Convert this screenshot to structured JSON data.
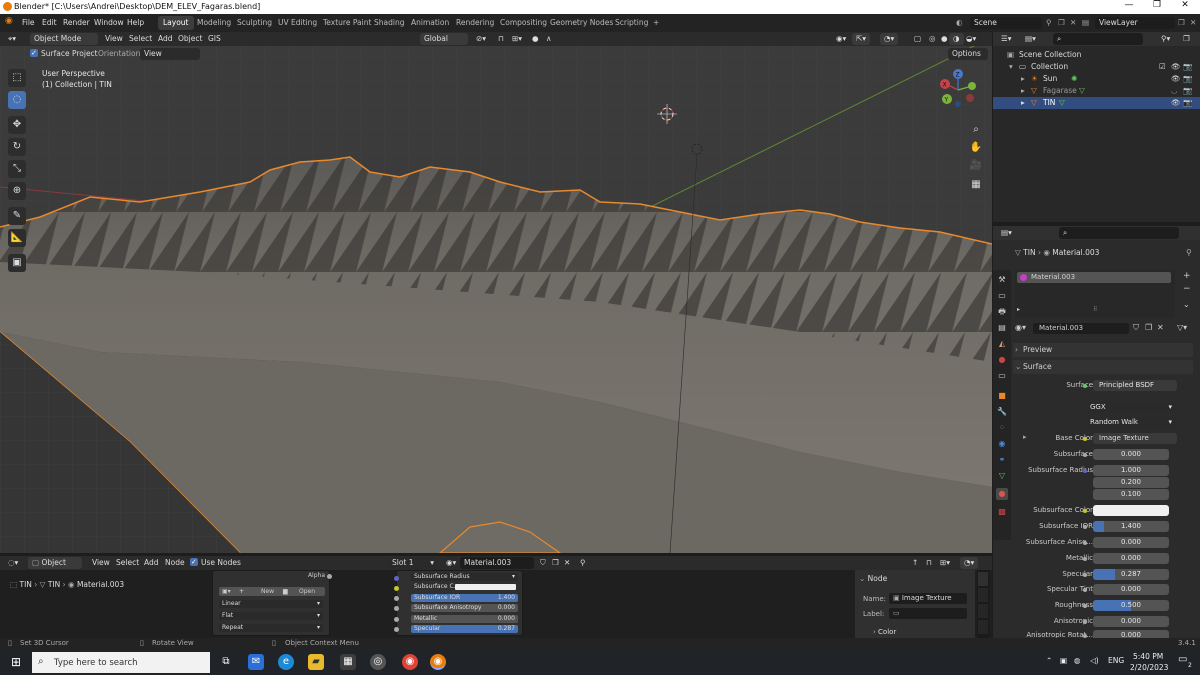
{
  "window": {
    "title": "Blender* [C:\\Users\\Andrei\\Desktop\\DEM_ELEV_Fagaras.blend]",
    "controls": [
      "—",
      "❐",
      "✕"
    ]
  },
  "menu": {
    "items": [
      "File",
      "Edit",
      "Render",
      "Window",
      "Help"
    ],
    "workspaces": [
      "Layout",
      "Modeling",
      "Sculpting",
      "UV Editing",
      "Texture Paint",
      "Shading",
      "Animation",
      "Rendering",
      "Compositing",
      "Geometry Nodes",
      "Scripting"
    ],
    "add_tab": "+",
    "scene": "Scene",
    "view_layer": "ViewLayer"
  },
  "viewport": {
    "mode": "Object Mode",
    "header_menus": [
      "View",
      "Select",
      "Add",
      "Object",
      "GIS"
    ],
    "transform_orientation": "Global",
    "surface_project": "Surface Project",
    "orientation_label": "Orientation:",
    "orientation_value": "View",
    "options": "Options",
    "overlay_title": "User Perspective",
    "overlay_sub": "(1) Collection | TIN",
    "gizmo": {
      "x": "X",
      "y": "Y",
      "z": "Z"
    }
  },
  "outliner": {
    "search_placeholder": "",
    "rows": [
      {
        "label": "Scene Collection"
      },
      {
        "label": "Collection"
      },
      {
        "label": "Sun"
      },
      {
        "label": "Fagarase"
      },
      {
        "label": "TIN"
      }
    ]
  },
  "properties": {
    "breadcrumb_obj": "TIN",
    "breadcrumb_mat": "Material.003",
    "slot_material": "Material.003",
    "material_name": "Material.003",
    "preview": "Preview",
    "surface_section": "Surface",
    "rows": [
      {
        "label": "Surface",
        "value": "Principled BSDF"
      },
      {
        "label": "",
        "value": "GGX"
      },
      {
        "label": "",
        "value": "Random Walk"
      },
      {
        "label": "Base Color",
        "value": "Image Texture"
      },
      {
        "label": "Subsurface",
        "value": "0.000"
      },
      {
        "label": "Subsurface Radius",
        "value": "1.000"
      },
      {
        "label": "",
        "value": "0.200"
      },
      {
        "label": "",
        "value": "0.100"
      },
      {
        "label": "Subsurface Color",
        "value": ""
      },
      {
        "label": "Subsurface IOR",
        "value": "1.400"
      },
      {
        "label": "Subsurface Aniso...",
        "value": "0.000"
      },
      {
        "label": "Metallic",
        "value": "0.000"
      },
      {
        "label": "Specular",
        "value": "0.287"
      },
      {
        "label": "Specular Tint",
        "value": "0.000"
      },
      {
        "label": "Roughness",
        "value": "0.500"
      },
      {
        "label": "Anisotropic",
        "value": "0.000"
      },
      {
        "label": "Anisotropic Rotat...",
        "value": "0.000"
      }
    ],
    "fills": {
      "subsurface_ior": 0.14,
      "specular": 0.287,
      "roughness": 0.5
    }
  },
  "node_editor": {
    "editor_type": "Object",
    "menus": [
      "View",
      "Select",
      "Add",
      "Node"
    ],
    "use_nodes": "Use Nodes",
    "slot": "Slot 1",
    "material": "Material.003",
    "breadcrumb": [
      "TIN",
      "TIN",
      "Material.003"
    ],
    "image_node": {
      "alpha": "Alpha",
      "new": "New",
      "open": "Open",
      "interp": "Linear",
      "proj": "Flat",
      "ext": "Repeat"
    },
    "bsdf_node": {
      "rows": [
        {
          "label": "Subsurface Radius",
          "value": ""
        },
        {
          "label": "Subsurface C...",
          "value": ""
        },
        {
          "label": "Subsurface IOR",
          "value": "1.400"
        },
        {
          "label": "Subsurface Anisotropy",
          "value": "0.000"
        },
        {
          "label": "Metallic",
          "value": "0.000"
        },
        {
          "label": "Specular",
          "value": "0.287"
        }
      ]
    },
    "side_panel": {
      "section": "Node",
      "name_label": "Name:",
      "name_value": "Image Texture",
      "label_label": "Label:",
      "color_section": "Color"
    }
  },
  "statusbar": {
    "left": "Set 3D Cursor",
    "mid": "Rotate View",
    "right": "Object Context Menu",
    "version": "3.4.1"
  },
  "taskbar": {
    "search_placeholder": "Type here to search",
    "lang": "ENG",
    "time": "5:40 PM",
    "date": "2/20/2023",
    "notif_count": "2"
  },
  "colors": {
    "accent": "#4772b3",
    "selection_outline": "#e8892d",
    "outliner_selected": "#334d80"
  }
}
